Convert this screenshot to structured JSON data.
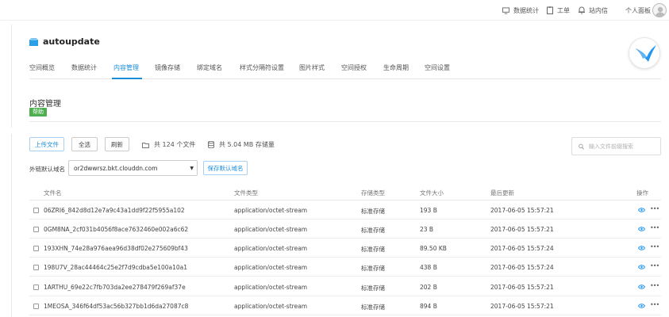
{
  "topbar": {
    "stats_label": "数据统计",
    "ticket_label": "工单",
    "messages_label": "站内信",
    "profile_label": "个人面板"
  },
  "space": {
    "name": "autoupdate",
    "icon": "bucket-icon",
    "logo": "swift-bird-logo"
  },
  "tabs": [
    {
      "label": "空间概览"
    },
    {
      "label": "数据统计"
    },
    {
      "label": "内容管理",
      "active": true
    },
    {
      "label": "镜像存储"
    },
    {
      "label": "绑定域名"
    },
    {
      "label": "样式分隔符设置"
    },
    {
      "label": "图片样式"
    },
    {
      "label": "空间授权"
    },
    {
      "label": "生命周期"
    },
    {
      "label": "空间设置"
    }
  ],
  "section": {
    "title": "内容管理",
    "help_badge": "帮助"
  },
  "toolbar": {
    "upload_label": "上传文件",
    "select_all_label": "全选",
    "refresh_label": "刷新",
    "file_count_text": "共 124 个文件",
    "storage_text": "共 5.04 MB 存储量",
    "search_placeholder": "输入文件前缀搜索"
  },
  "domain": {
    "label": "外链默认域名",
    "selected": "or2dwwrsz.bkt.clouddn.com",
    "save_label": "保存默认域名"
  },
  "table": {
    "headers": {
      "name": "文件名",
      "type": "文件类型",
      "storage": "存储类型",
      "size": "文件大小",
      "updated": "最后更新",
      "actions": "操作"
    },
    "rows": [
      {
        "name": "06ZRI6_842d8d12e7a9c43a1dd9f22f5955a102",
        "type": "application/octet-stream",
        "storage": "标准存储",
        "size": "193 B",
        "updated": "2017-06-05 15:57:21"
      },
      {
        "name": "0GM8NA_2cf031b4056f8ace7632460e002a6c62",
        "type": "application/octet-stream",
        "storage": "标准存储",
        "size": "23 B",
        "updated": "2017-06-05 15:57:21"
      },
      {
        "name": "193XHN_74e28a976aea96d38df02e275609bf43",
        "type": "application/octet-stream",
        "storage": "标准存储",
        "size": "89.50 KB",
        "updated": "2017-06-05 15:57:24"
      },
      {
        "name": "198U7V_28ac44464c25e2f7d9cdba5e100a10a1",
        "type": "application/octet-stream",
        "storage": "标准存储",
        "size": "438 B",
        "updated": "2017-06-05 15:57:24"
      },
      {
        "name": "1ARTHU_69e22c7fb703da2ee278479f269af37e",
        "type": "application/octet-stream",
        "storage": "标准存储",
        "size": "202 B",
        "updated": "2017-06-05 15:57:21"
      },
      {
        "name": "1MEOSA_346f64df53ac56b327bb1d6da27087c8",
        "type": "application/octet-stream",
        "storage": "标准存储",
        "size": "894 B",
        "updated": "2017-06-05 15:57:21"
      }
    ]
  },
  "colors": {
    "accent": "#1a8cd8",
    "help_badge": "#4caf50",
    "logo_blue": "#2196f3"
  }
}
